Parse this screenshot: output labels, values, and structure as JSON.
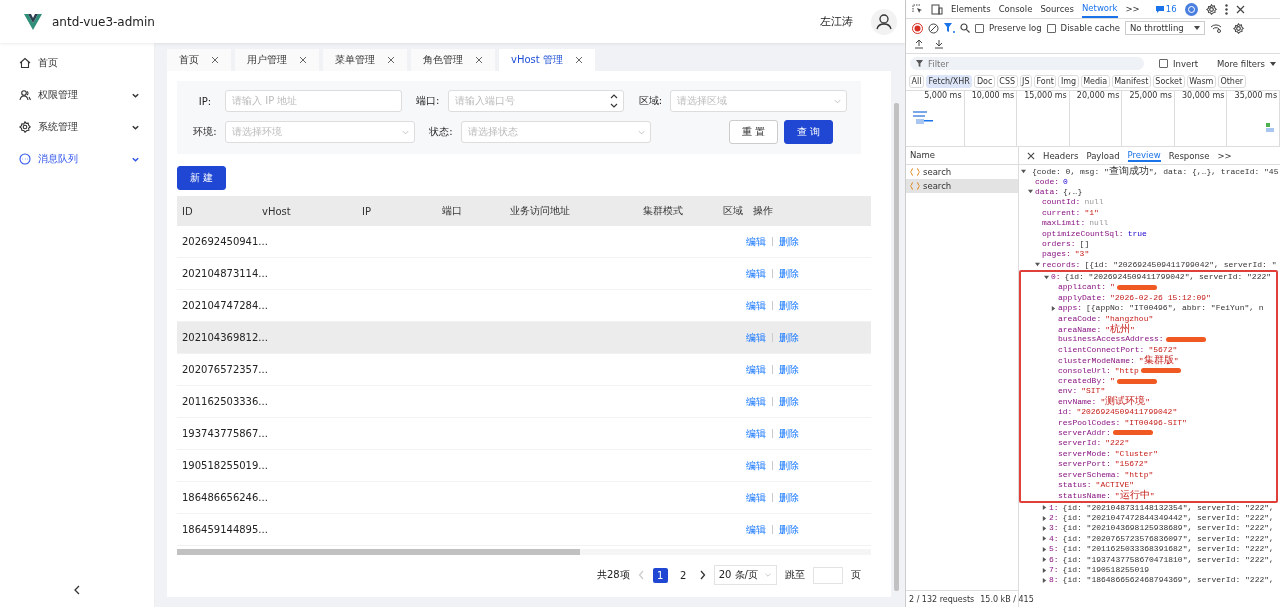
{
  "app": {
    "title": "antd-vue3-admin",
    "user": "左江涛",
    "sidebar": [
      {
        "label": "首页",
        "expandable": false,
        "selected": false
      },
      {
        "label": "权限管理",
        "expandable": true,
        "selected": false
      },
      {
        "label": "系统管理",
        "expandable": true,
        "selected": false
      },
      {
        "label": "消息队列",
        "expandable": true,
        "selected": true
      }
    ],
    "tabs": [
      {
        "label": "首页",
        "selected": false
      },
      {
        "label": "用户管理",
        "selected": false
      },
      {
        "label": "菜单管理",
        "selected": false
      },
      {
        "label": "角色管理",
        "selected": false
      },
      {
        "label": "vHost 管理",
        "selected": true
      }
    ],
    "filters": [
      {
        "label": "IP:",
        "placeholder": "请输入 IP 地址",
        "kind": "input"
      },
      {
        "label": "端口:",
        "placeholder": "请输入端口号",
        "kind": "number"
      },
      {
        "label": "区域:",
        "placeholder": "请选择区域",
        "kind": "select"
      },
      {
        "label": "环境:",
        "placeholder": "请选择环境",
        "kind": "select"
      },
      {
        "label": "状态:",
        "placeholder": "请选择状态",
        "kind": "select"
      }
    ],
    "reset_button": "重 置",
    "query_button": "查 询",
    "new_button": "新 建",
    "table": {
      "columns": [
        "ID",
        "vHost",
        "IP",
        "端口",
        "业务访问地址",
        "集群模式",
        "区域",
        "操作"
      ],
      "rows": [
        {
          "id": "202692450941...",
          "edit": "编辑",
          "delete": "删除",
          "hovered": false
        },
        {
          "id": "202104873114...",
          "edit": "编辑",
          "delete": "删除",
          "hovered": false
        },
        {
          "id": "202104747284...",
          "edit": "编辑",
          "delete": "删除",
          "hovered": false
        },
        {
          "id": "202104369812...",
          "edit": "编辑",
          "delete": "删除",
          "hovered": true
        },
        {
          "id": "202076572357...",
          "edit": "编辑",
          "delete": "删除",
          "hovered": false
        },
        {
          "id": "201162503336...",
          "edit": "编辑",
          "delete": "删除",
          "hovered": false
        },
        {
          "id": "193743775867...",
          "edit": "编辑",
          "delete": "删除",
          "hovered": false
        },
        {
          "id": "190518255019...",
          "edit": "编辑",
          "delete": "删除",
          "hovered": false
        },
        {
          "id": "186486656246...",
          "edit": "编辑",
          "delete": "删除",
          "hovered": false
        },
        {
          "id": "186459144895...",
          "edit": "编辑",
          "delete": "删除",
          "hovered": false
        }
      ]
    },
    "pagination": {
      "total": "共28项",
      "pages": [
        {
          "label": "1",
          "selected": true
        },
        {
          "label": "2",
          "selected": false
        }
      ],
      "page_size": "20 条/页",
      "jump_label": "跳至",
      "jump_suffix": "页"
    }
  },
  "devtools": {
    "tabs": [
      {
        "label": "Elements",
        "selected": false
      },
      {
        "label": "Console",
        "selected": false
      },
      {
        "label": "Sources",
        "selected": false
      },
      {
        "label": "Network",
        "selected": true
      }
    ],
    "more_tabs": ">>",
    "issues_count": "16",
    "preserve_log": {
      "label": "Preserve log",
      "checked": false
    },
    "disable_cache": {
      "label": "Disable cache",
      "checked": false
    },
    "throttling": "No throttling",
    "filter_placeholder": "Filter",
    "invert": {
      "label": "Invert",
      "checked": false
    },
    "more_filters": "More filters",
    "type_filters": [
      {
        "label": "All",
        "selected": false
      },
      {
        "label": "Fetch/XHR",
        "selected": true
      },
      {
        "label": "Doc",
        "selected": false
      },
      {
        "label": "CSS",
        "selected": false
      },
      {
        "label": "JS",
        "selected": false
      },
      {
        "label": "Font",
        "selected": false
      },
      {
        "label": "Img",
        "selected": false
      },
      {
        "label": "Media",
        "selected": false
      },
      {
        "label": "Manifest",
        "selected": false
      },
      {
        "label": "Socket",
        "selected": false
      },
      {
        "label": "Wasm",
        "selected": false
      },
      {
        "label": "Other",
        "selected": false
      }
    ],
    "timeline_ticks": [
      "5,000 ms",
      "10,000 ms",
      "15,000 ms",
      "20,000 ms",
      "25,000 ms",
      "30,000 ms",
      "35,000 ms"
    ],
    "name_header": "Name",
    "requests": [
      {
        "name": "search",
        "selected": false
      },
      {
        "name": "search",
        "selected": true
      }
    ],
    "detail_tabs": [
      {
        "label": "Headers",
        "selected": false
      },
      {
        "label": "Payload",
        "selected": false
      },
      {
        "label": "Preview",
        "selected": true
      },
      {
        "label": "Response",
        "selected": false
      }
    ],
    "detail_more": ">>",
    "preview": [
      {
        "value": "{code: 0, msg: \"查询成功\", data: {,…}, traceId: \"45",
        "kind": "preview",
        "expanded": true,
        "children": [
          {
            "key": "code:",
            "value": "0",
            "kind": "number"
          },
          {
            "key": "data:",
            "value": "{,…}",
            "kind": "preview",
            "expanded": true,
            "children": [
              {
                "key": "countId:",
                "value": "null",
                "kind": "null"
              },
              {
                "key": "current:",
                "value": "\"1\"",
                "kind": "string"
              },
              {
                "key": "maxLimit:",
                "value": "null",
                "kind": "null"
              },
              {
                "key": "optimizeCountSql:",
                "value": "true",
                "kind": "bool"
              },
              {
                "key": "orders:",
                "value": "[]",
                "kind": "preview"
              },
              {
                "key": "pages:",
                "value": "\"3\"",
                "kind": "string"
              },
              {
                "key": "records:",
                "value": "[{id: \"2026924509411799042\", serverId: \"",
                "kind": "preview",
                "expanded": true,
                "children": [
                  {
                    "key": "0:",
                    "value": "{id: \"2026924509411799042\", serverId: \"222\"",
                    "kind": "preview",
                    "expanded": true,
                    "highlighted": true,
                    "children": [
                      {
                        "key": "applicant:",
                        "value": "\"",
                        "kind": "string",
                        "redacted": true
                      },
                      {
                        "key": "applyDate:",
                        "value": "\"2026-02-26 15:12:09\"",
                        "kind": "string"
                      },
                      {
                        "key": "apps:",
                        "value": "[{appNo: \"IT00496\", abbr: \"FeiYun\", n",
                        "kind": "preview",
                        "expanded": false
                      },
                      {
                        "key": "areaCode:",
                        "value": "\"hangzhou\"",
                        "kind": "string"
                      },
                      {
                        "key": "areaName:",
                        "value": "\"杭州\"",
                        "kind": "string"
                      },
                      {
                        "key": "businessAccessAddress:",
                        "redacted": true
                      },
                      {
                        "key": "clientConnectPort:",
                        "value": "\"5672\"",
                        "kind": "string"
                      },
                      {
                        "key": "clusterModeName:",
                        "value": "\"集群版\"",
                        "kind": "string"
                      },
                      {
                        "key": "consoleUrl:",
                        "value": "\"http",
                        "kind": "string",
                        "redacted": true
                      },
                      {
                        "key": "createdBy:",
                        "value": "\"",
                        "kind": "string",
                        "redacted": true
                      },
                      {
                        "key": "env:",
                        "value": "\"SIT\"",
                        "kind": "string"
                      },
                      {
                        "key": "envName:",
                        "value": "\"测试环境\"",
                        "kind": "string"
                      },
                      {
                        "key": "id:",
                        "value": "\"2026924509411799042\"",
                        "kind": "string"
                      },
                      {
                        "key": "resPoolCodes:",
                        "value": "\"IT00496-SIT\"",
                        "kind": "string"
                      },
                      {
                        "key": "serverAddr:",
                        "redacted": true
                      },
                      {
                        "key": "serverId:",
                        "value": "\"222\"",
                        "kind": "string"
                      },
                      {
                        "key": "serverMode:",
                        "value": "\"Cluster\"",
                        "kind": "string"
                      },
                      {
                        "key": "serverPort:",
                        "value": "\"15672\"",
                        "kind": "string"
                      },
                      {
                        "key": "serverSchema:",
                        "value": "\"http\"",
                        "kind": "string"
                      },
                      {
                        "key": "status:",
                        "value": "\"ACTIVE\"",
                        "kind": "string"
                      },
                      {
                        "key": "statusName:",
                        "value": "\"运行中\"",
                        "kind": "string"
                      }
                    ]
                  },
                  {
                    "key": "1:",
                    "value": "{id: \"2021048731148132354\", serverId: \"222\",",
                    "kind": "preview",
                    "expanded": false
                  },
                  {
                    "key": "2:",
                    "value": "{id: \"2021047472844349442\", serverId: \"222\",",
                    "kind": "preview",
                    "expanded": false
                  },
                  {
                    "key": "3:",
                    "value": "{id: \"2021043698125938689\", serverId: \"222\",",
                    "kind": "preview",
                    "expanded": false
                  },
                  {
                    "key": "4:",
                    "value": "{id: \"2020765723576836097\", serverId: \"222\",",
                    "kind": "preview",
                    "expanded": false
                  },
                  {
                    "key": "5:",
                    "value": "{id: \"2011625033368391682\", serverId: \"222\",",
                    "kind": "preview",
                    "expanded": false
                  },
                  {
                    "key": "6:",
                    "value": "{id: \"1937437758670471810\", serverId: \"222\",",
                    "kind": "preview",
                    "expanded": false
                  },
                  {
                    "key": "7:",
                    "value": "{id: \"190518255019",
                    "kind": "preview",
                    "expanded": false
                  },
                  {
                    "key": "8:",
                    "value": "{id: \"1864866562468794369\", serverId: \"222\",",
                    "kind": "preview",
                    "expanded": false
                  }
                ]
              }
            ]
          }
        ]
      }
    ],
    "status": {
      "requests": "2 / 132 requests",
      "transferred": "15.0 kB / 415"
    }
  }
}
